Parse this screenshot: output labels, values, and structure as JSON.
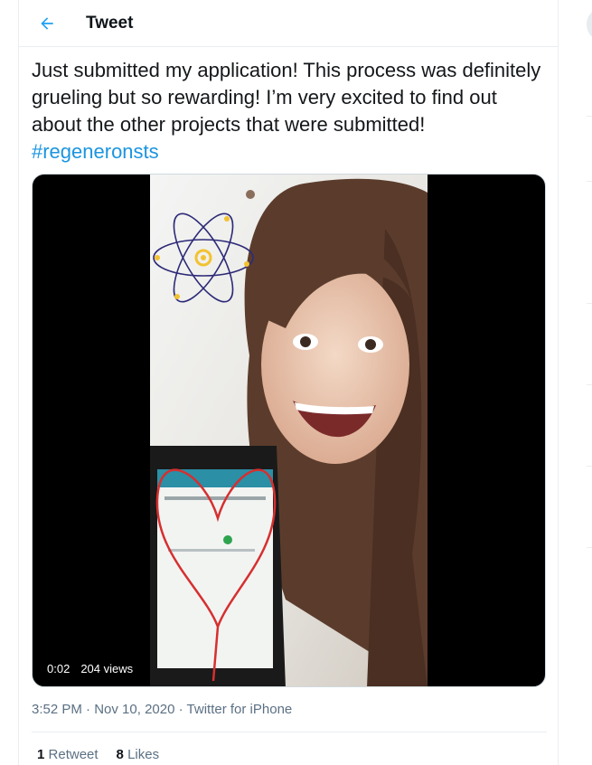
{
  "header": {
    "title": "Tweet",
    "back_icon": "arrow-left-icon"
  },
  "tweet": {
    "text": "Just submitted my application! This process was definitely grueling but so rewarding! I’m very excited to find out about the other projects that were submitted!",
    "hashtag": "#regeneronsts",
    "media": {
      "time": "0:02",
      "views": "204 views"
    },
    "time": "3:52 PM",
    "date": "Nov 10, 2020",
    "source": "Twitter for iPhone",
    "retweet_count": "1",
    "retweet_label": "Retweet",
    "like_count": "8",
    "like_label": "Likes"
  },
  "colors": {
    "link": "#1b95e0",
    "secondary_text": "#5b7083",
    "border": "#ebeef0"
  }
}
